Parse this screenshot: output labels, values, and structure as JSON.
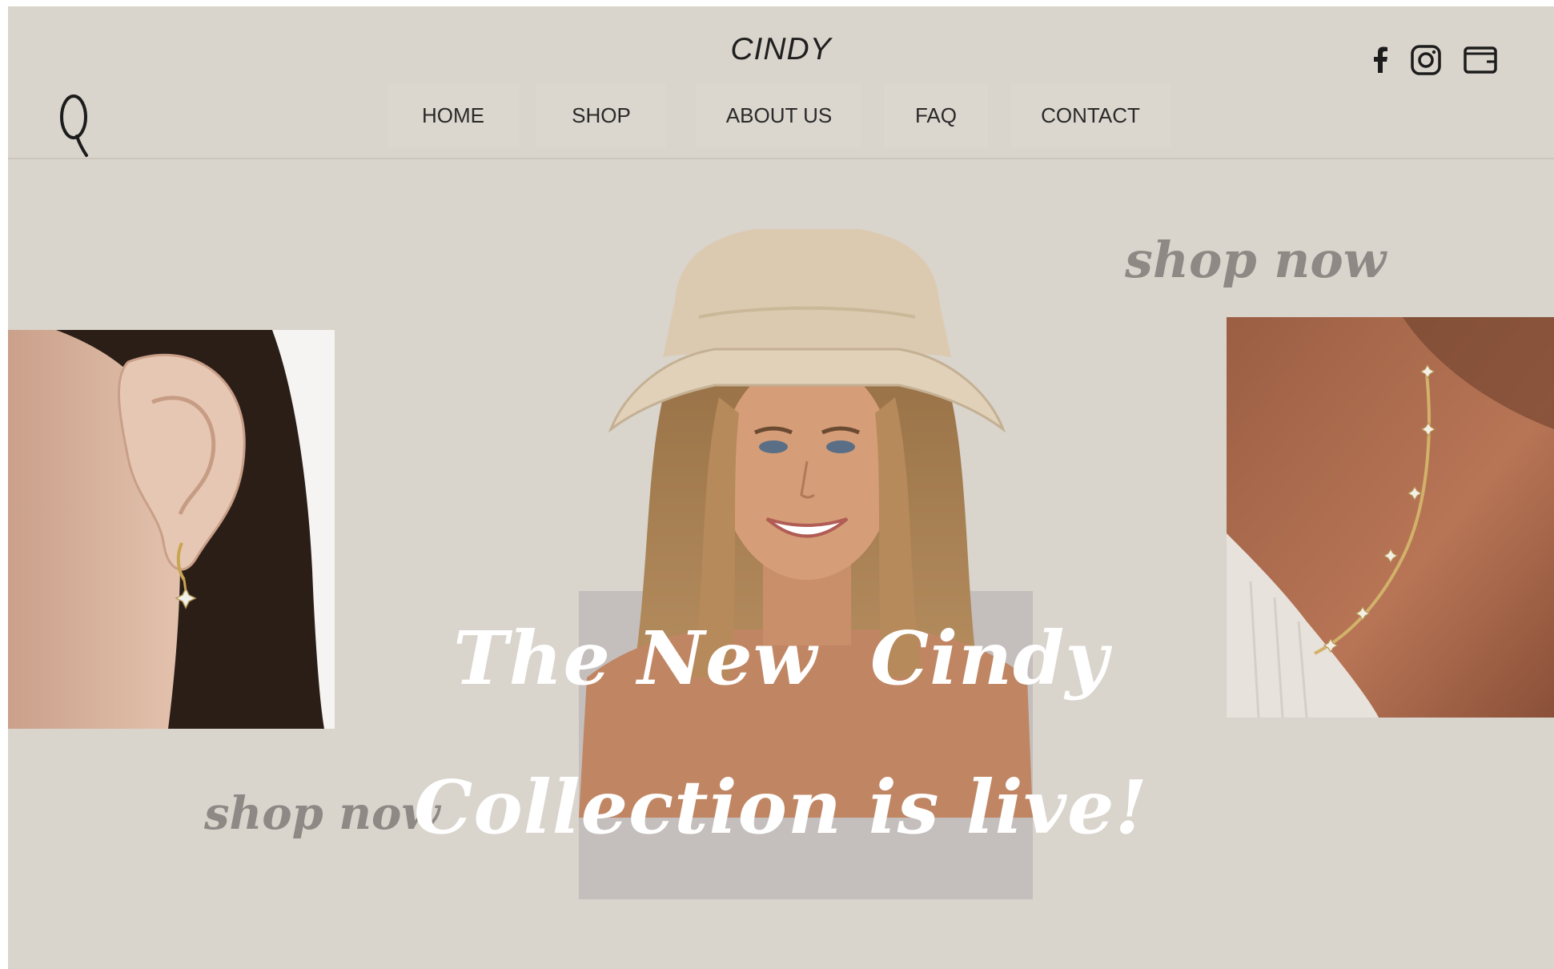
{
  "header": {
    "brand": "CINDY",
    "nav": [
      {
        "label": "HOME"
      },
      {
        "label": "SHOP"
      },
      {
        "label": "ABOUT US"
      },
      {
        "label": "FAQ"
      },
      {
        "label": "CONTACT"
      }
    ],
    "icons": {
      "search": "search-icon",
      "social": [
        "facebook-icon",
        "instagram-icon",
        "wallet-icon"
      ]
    }
  },
  "hero": {
    "headline_line1": "The New  Cindy",
    "headline_line2": "Collection is live!",
    "shop_now_top": "shop now",
    "shop_now_bottom": "shop now"
  },
  "colors": {
    "background": "#d9d4cc",
    "nav_text": "#2a2a2a",
    "script_gray": "#8f8985",
    "headline": "#ffffff"
  }
}
